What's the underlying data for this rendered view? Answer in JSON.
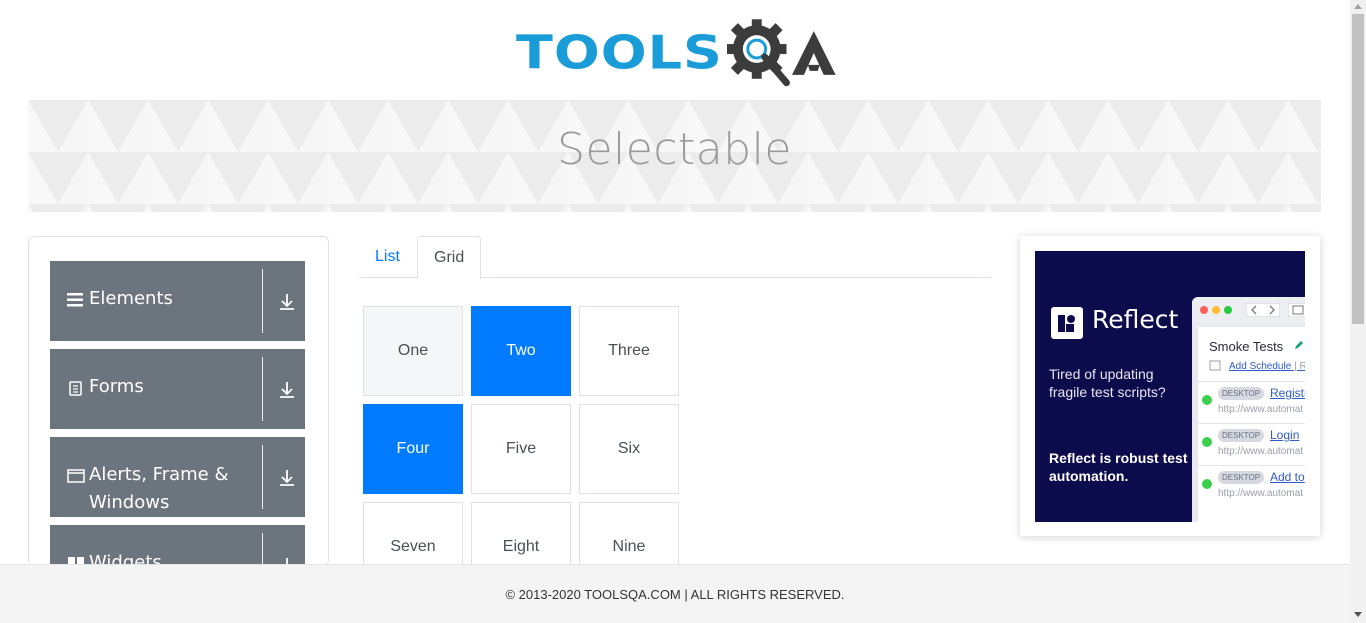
{
  "logo": {
    "text_part": "TOOLS",
    "icon": "gear-magnifier-icon",
    "suffix_icon": "letter-a-icon",
    "colors": {
      "blue": "#1a9cd8",
      "dark": "#3c3c3c"
    }
  },
  "banner": {
    "title": "Selectable"
  },
  "sidebar": {
    "groups": [
      {
        "label": "Elements",
        "icon": "menu-icon",
        "arrow": "download-arrow-icon"
      },
      {
        "label": "Forms",
        "icon": "document-icon",
        "arrow": "download-arrow-icon"
      },
      {
        "label": "Alerts, Frame & Windows",
        "icon": "window-icon",
        "arrow": "download-arrow-icon"
      },
      {
        "label": "Widgets",
        "icon": "widgets-icon",
        "arrow": "download-arrow-icon"
      }
    ]
  },
  "tabs": [
    {
      "label": "List",
      "active": false
    },
    {
      "label": "Grid",
      "active": true
    }
  ],
  "grid": {
    "cells": [
      {
        "label": "One",
        "state": "hover"
      },
      {
        "label": "Two",
        "state": "active"
      },
      {
        "label": "Three",
        "state": "normal"
      },
      {
        "label": "Four",
        "state": "active"
      },
      {
        "label": "Five",
        "state": "normal"
      },
      {
        "label": "Six",
        "state": "normal"
      },
      {
        "label": "Seven",
        "state": "normal"
      },
      {
        "label": "Eight",
        "state": "normal"
      },
      {
        "label": "Nine",
        "state": "normal"
      }
    ]
  },
  "ad": {
    "brand": "Reflect",
    "tagline1": "Tired of updating fragile test scripts?",
    "tagline2": "Reflect is robust test automation.",
    "window": {
      "title": "Smoke Tests",
      "schedule_link": "Add Schedule",
      "schedule_sep": "| Ru",
      "rows": [
        {
          "badge": "DESKTOP",
          "name": "Registr",
          "url": "http://www.automat"
        },
        {
          "badge": "DESKTOP",
          "name": "Login",
          "url": "http://www.automat"
        },
        {
          "badge": "DESKTOP",
          "name": "Add to",
          "url": "http://www.automat"
        }
      ]
    }
  },
  "footer": {
    "text": "© 2013-2020 TOOLSQA.COM | ALL RIGHTS RESERVED."
  },
  "colors": {
    "accent": "#007bff",
    "sidebar_bg": "#6c757d",
    "ad_bg": "#0c0b4c"
  }
}
